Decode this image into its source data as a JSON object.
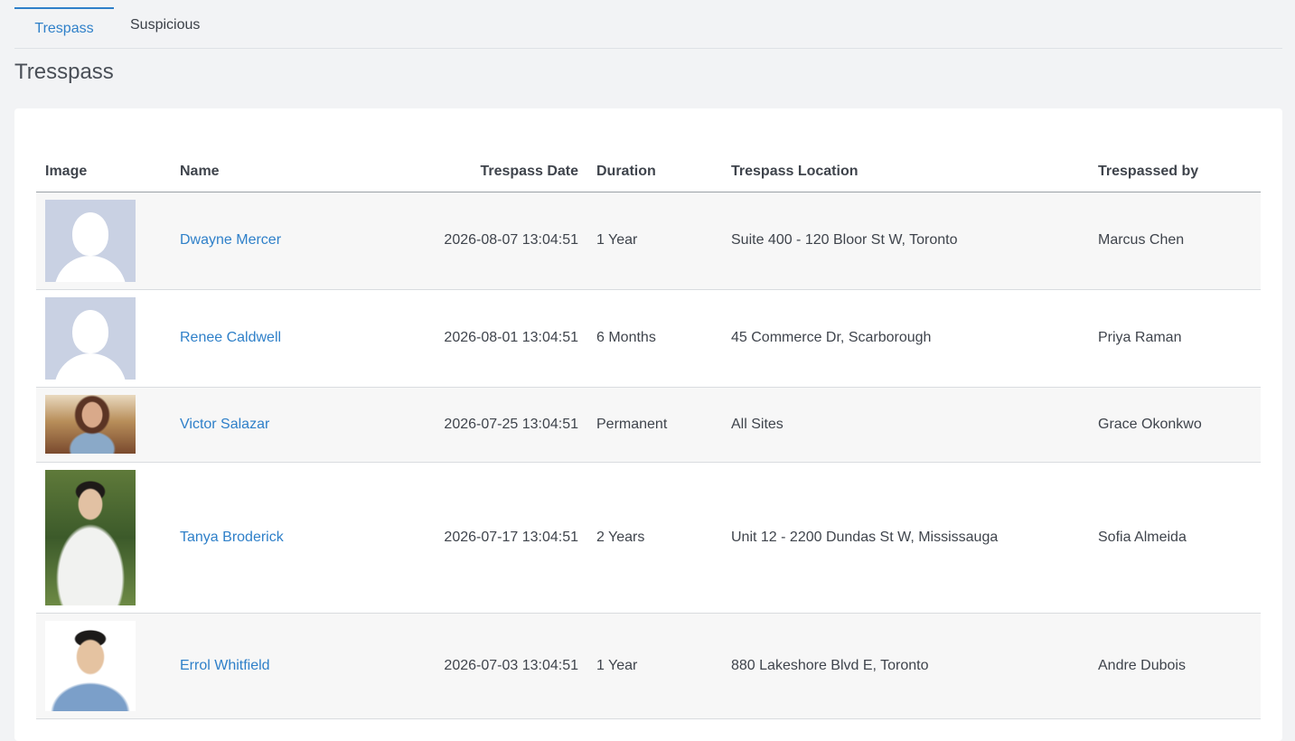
{
  "tabs": [
    {
      "label": "Trespass",
      "active": true
    },
    {
      "label": "Suspicious",
      "active": false
    }
  ],
  "page_title": "Tresspass",
  "table": {
    "columns": [
      "Image",
      "Name",
      "Trespass Date",
      "Duration",
      "Trespass Location",
      "Trespassed by"
    ],
    "rows": [
      {
        "image": "placeholder-avatar",
        "name": "Dwayne Mercer",
        "date": "2026-08-07 13:04:51",
        "duration": "1 Year",
        "location": "Suite 400 - 120 Bloor St W, Toronto",
        "by": "Marcus Chen"
      },
      {
        "image": "placeholder-avatar",
        "name": "Renee Caldwell",
        "date": "2026-08-01 13:04:51",
        "duration": "6 Months",
        "location": "45 Commerce Dr, Scarborough",
        "by": "Priya Raman"
      },
      {
        "image": "photo-woman",
        "name": "Victor Salazar",
        "date": "2026-07-25 13:04:51",
        "duration": "Permanent",
        "location": "All Sites",
        "by": "Grace Okonkwo"
      },
      {
        "image": "photo-man-outdoor",
        "name": "Tanya Broderick",
        "date": "2026-07-17 13:04:51",
        "duration": "2 Years",
        "location": "Unit 12 - 2200 Dundas St W, Mississauga",
        "by": "Sofia Almeida"
      },
      {
        "image": "photo-man-portrait",
        "name": "Errol Whitfield",
        "date": "2026-07-03 13:04:51",
        "duration": "1 Year",
        "location": "880 Lakeshore Blvd E, Toronto",
        "by": "Andre Dubois"
      }
    ]
  },
  "colors": {
    "accent": "#2f80c9",
    "placeholder": "#c9d1e3",
    "page_bg": "#f2f3f5"
  }
}
